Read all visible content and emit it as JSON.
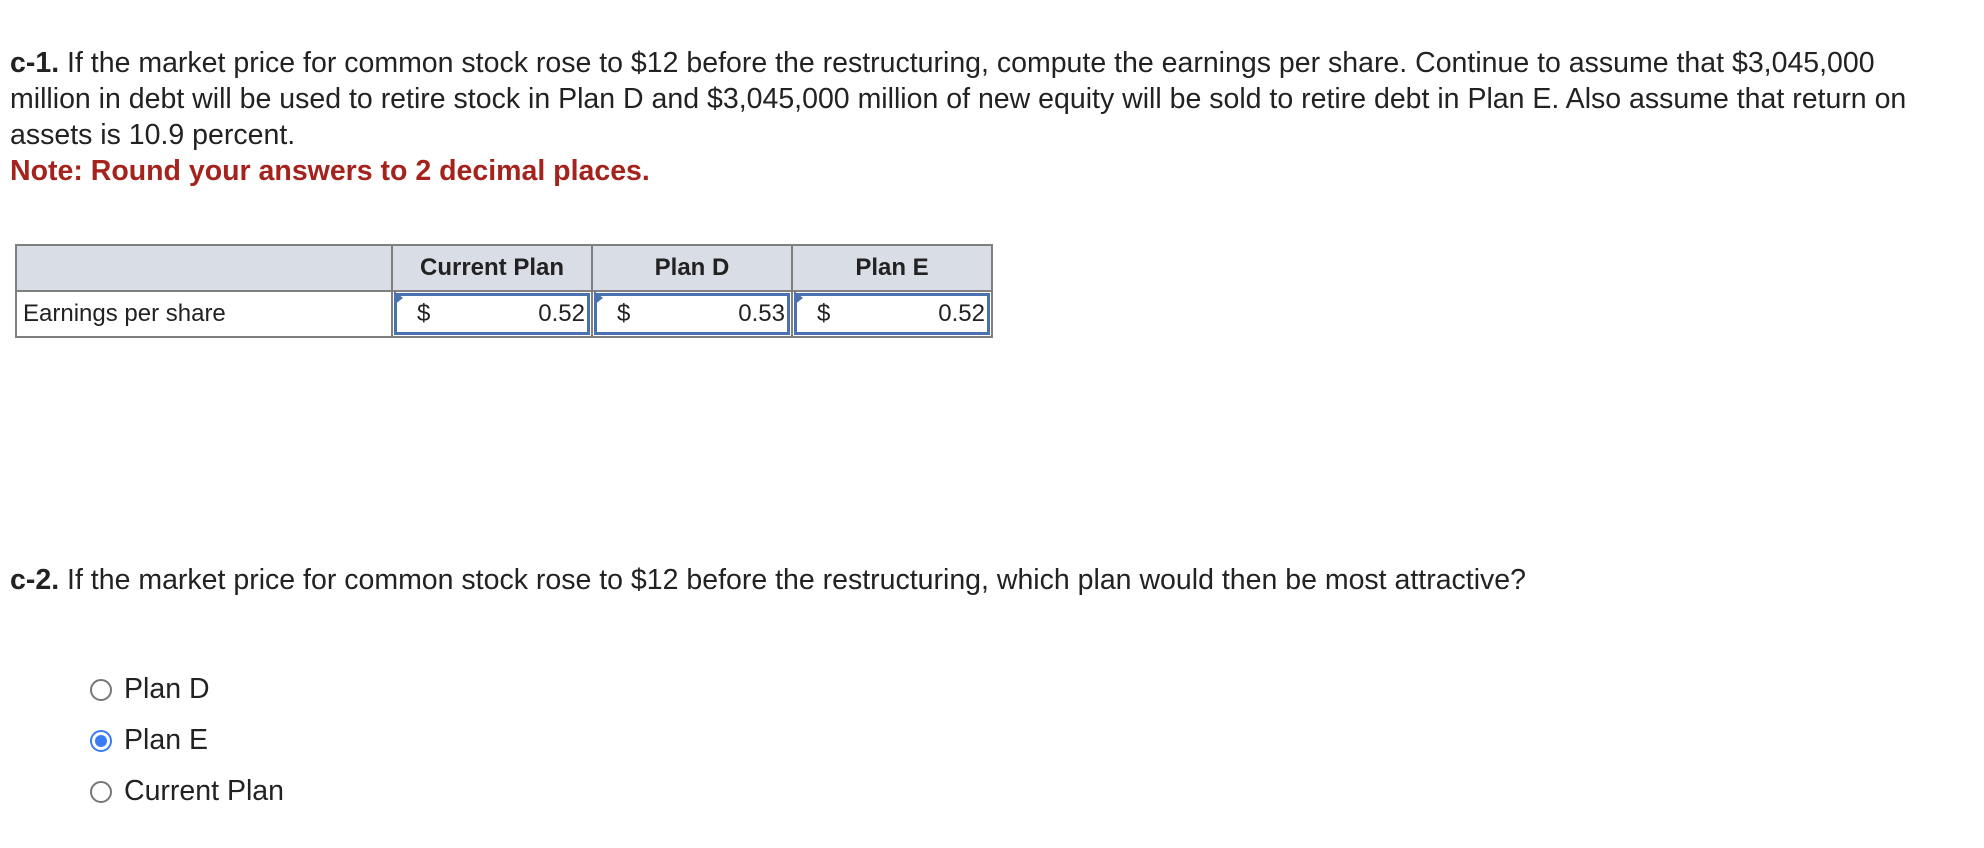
{
  "question_c1": {
    "label": "c-1.",
    "text": " If the market price for common stock rose to $12 before the restructuring, compute the earnings per share. Continue to assume that $3,045,000 million in debt will be used to retire stock in Plan D and $3,045,000 million of new equity will be sold to retire debt in Plan E. Also assume that return on assets is 10.9 percent.",
    "note": "Note: Round your answers to 2 decimal places."
  },
  "table": {
    "columns": [
      "",
      "Current Plan",
      "Plan D",
      "Plan E"
    ],
    "rows": [
      {
        "label": "Earnings per share",
        "cells": [
          {
            "currency": "$",
            "value": "0.52"
          },
          {
            "currency": "$",
            "value": "0.53"
          },
          {
            "currency": "$",
            "value": "0.52"
          }
        ]
      }
    ]
  },
  "question_c2": {
    "label": "c-2.",
    "text": " If the market price for common stock rose to $12 before the restructuring, which plan would then be most attractive?"
  },
  "options": [
    {
      "label": "Plan D",
      "selected": false
    },
    {
      "label": "Plan E",
      "selected": true
    },
    {
      "label": "Current Plan",
      "selected": false
    }
  ],
  "colors": {
    "note": "#a5231d",
    "header_bg": "#d9dde6",
    "input_border": "#4a72b0",
    "radio_selected": "#3b7bf6"
  }
}
